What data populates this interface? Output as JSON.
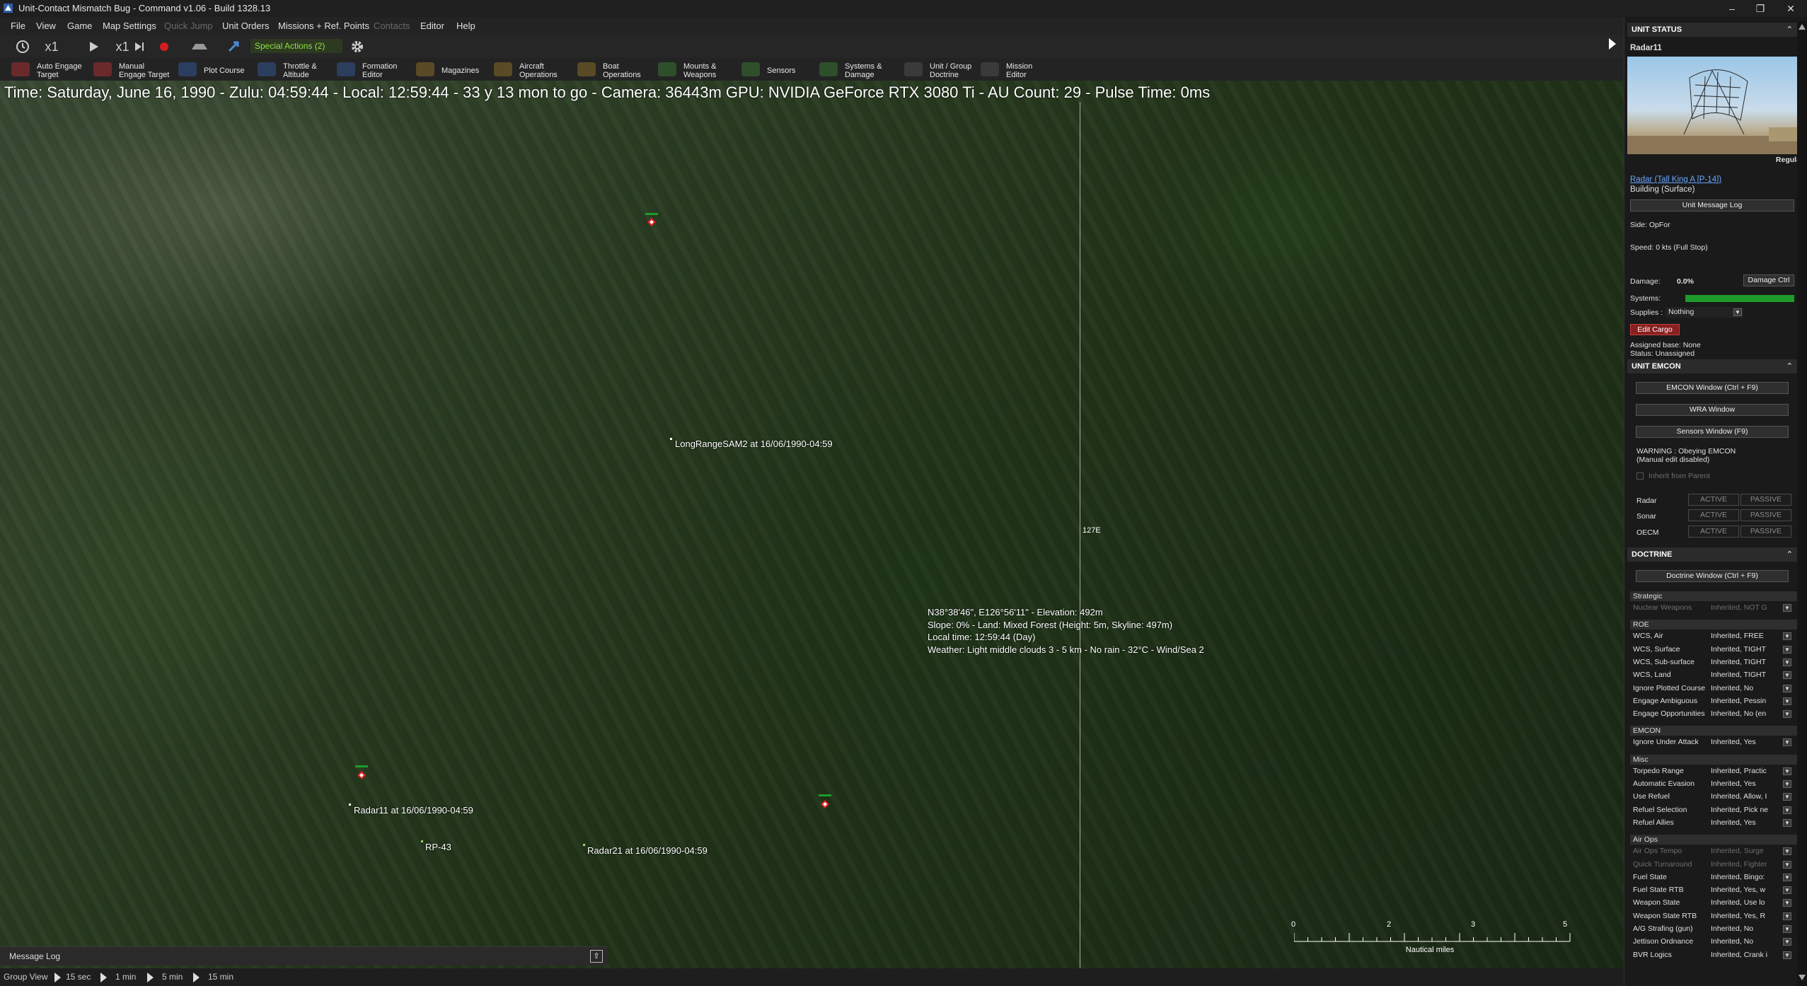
{
  "window": {
    "title": "Unit-Contact Mismatch Bug  - Command v1.06 - Build 1328.13",
    "controls": [
      "–",
      "❐",
      "✕"
    ]
  },
  "menu": {
    "items": [
      {
        "label": "File",
        "enabled": true
      },
      {
        "label": "View",
        "enabled": true
      },
      {
        "label": "Game",
        "enabled": true
      },
      {
        "label": "Map Settings",
        "enabled": true
      },
      {
        "label": "Quick Jump",
        "enabled": false
      },
      {
        "label": "Unit Orders",
        "enabled": true
      },
      {
        "label": "Missions + Ref. Points",
        "enabled": true
      },
      {
        "label": "Contacts",
        "enabled": false
      },
      {
        "label": "Editor",
        "enabled": true
      },
      {
        "label": "Help",
        "enabled": true
      }
    ]
  },
  "controls": {
    "speed1": "x1",
    "speed2": "x1",
    "special_actions": "Special Actions (2)"
  },
  "toolbar": {
    "buttons": [
      {
        "line1": "Auto Engage",
        "line2": "Target",
        "color": "#6b2a2a"
      },
      {
        "line1": "Manual",
        "line2": "Engage Target",
        "color": "#6b2a2a"
      },
      {
        "line1": "Plot Course",
        "line2": "",
        "color": "#2c3e5e"
      },
      {
        "line1": "Throttle &",
        "line2": "Altitude",
        "color": "#2c3e5e"
      },
      {
        "line1": "Formation",
        "line2": "Editor",
        "color": "#2c3e5e"
      },
      {
        "line1": "Magazines",
        "line2": "",
        "color": "#5a4a25"
      },
      {
        "line1": "Aircraft",
        "line2": "Operations",
        "color": "#5a4a25"
      },
      {
        "line1": "Boat",
        "line2": "Operations",
        "color": "#5a4a25"
      },
      {
        "line1": "Mounts &",
        "line2": "Weapons",
        "color": "#2e4f2a"
      },
      {
        "line1": "Sensors",
        "line2": "",
        "color": "#2e4f2a"
      },
      {
        "line1": "Systems &",
        "line2": "Damage",
        "color": "#2e4f2a"
      },
      {
        "line1": "Unit / Group",
        "line2": "Doctrine",
        "color": "#3a3a3a"
      },
      {
        "line1": "Mission",
        "line2": "Editor",
        "color": "#3a3a3a"
      }
    ]
  },
  "status_line": "Time: Saturday, June 16, 1990 - Zulu: 04:59:44 - Local: 12:59:44 - 33 y 13 mon to go -  Camera: 36443m  GPU: NVIDIA GeForce RTX 3080 Ti - AU Count: 29 - Pulse Time: 0ms",
  "map": {
    "meridian_label": "127E",
    "labels": {
      "sam": "LongRangeSAM2 at 16/06/1990-04:59",
      "radar11": "Radar11 at 16/06/1990-04:59",
      "rp43": "RP-43",
      "radar21": "Radar21 at 16/06/1990-04:59"
    },
    "cursor_info": [
      "N38°38'46\", E126°56'11\" - Elevation: 492m",
      "Slope: 0%  - Land: Mixed Forest (Height: 5m, Skyline: 497m)",
      "Local time: 12:59:44 (Day)",
      "Weather: Light middle clouds 3 - 5 km - No rain - 32°C - Wind/Sea 2"
    ],
    "scale": {
      "ticks": [
        "0",
        "2",
        "3",
        "5"
      ],
      "unit": "Nautical miles"
    }
  },
  "message_log": {
    "label": "Message Log"
  },
  "group_view": {
    "label": "Group View",
    "steps": [
      "15 sec",
      "1 min",
      "5 min",
      "15 min"
    ]
  },
  "unit_status": {
    "header": "UNIT STATUS",
    "unit_name": "Radar11",
    "proficiency": "Regular",
    "unit_type_link": "Radar (Tall King A [P-14])",
    "category": "Building (Surface)",
    "message_log_button": "Unit Message Log",
    "side": "Side: OpFor",
    "speed": "Speed: 0 kts (Full Stop)",
    "damage_label": "Damage:",
    "damage_value": "0.0%",
    "damage_ctrl": "Damage Ctrl",
    "systems_label": "Systems:",
    "supplies_label": "Supplies :",
    "supplies_value": "Nothing",
    "edit_cargo": "Edit Cargo",
    "assigned_base": "Assigned base: None",
    "status": "Status: Unassigned"
  },
  "emcon": {
    "header": "UNIT EMCON",
    "buttons": [
      "EMCON Window (Ctrl + F9)",
      "WRA Window",
      "Sensors Window (F9)"
    ],
    "warning1": "WARNING : Obeying EMCON",
    "warning2": "(Manual edit disabled)",
    "inherit": "Inherit from Parent",
    "rows": [
      {
        "label": "Radar",
        "active": "ACTIVE",
        "passive": "PASSIVE"
      },
      {
        "label": "Sonar",
        "active": "ACTIVE",
        "passive": "PASSIVE"
      },
      {
        "label": "OECM",
        "active": "ACTIVE",
        "passive": "PASSIVE"
      }
    ]
  },
  "doctrine": {
    "header": "DOCTRINE",
    "button": "Doctrine Window (Ctrl + F9)",
    "groups": [
      {
        "title": "Strategic",
        "rows": [
          {
            "k": "Nuclear Weapons",
            "v": "Inherited, NOT G",
            "disabled": true
          }
        ]
      },
      {
        "title": "ROE",
        "rows": [
          {
            "k": "WCS, Air",
            "v": "Inherited, FREE",
            "disabled": false
          },
          {
            "k": "WCS, Surface",
            "v": "Inherited, TIGHT",
            "disabled": false
          },
          {
            "k": "WCS, Sub-surface",
            "v": "Inherited, TIGHT",
            "disabled": false
          },
          {
            "k": "WCS, Land",
            "v": "Inherited, TIGHT",
            "disabled": false
          },
          {
            "k": "Ignore Plotted Course",
            "v": "Inherited, No",
            "disabled": false
          },
          {
            "k": "Engage Ambiguous",
            "v": "Inherited, Pessin",
            "disabled": false
          },
          {
            "k": "Engage Opportunities",
            "v": "Inherited, No (en",
            "disabled": false
          }
        ]
      },
      {
        "title": "EMCON",
        "rows": [
          {
            "k": "Ignore Under Attack",
            "v": "Inherited, Yes",
            "disabled": false
          }
        ]
      },
      {
        "title": "Misc",
        "rows": [
          {
            "k": "Torpedo Range",
            "v": "Inherited, Practic",
            "disabled": false
          },
          {
            "k": "Automatic Evasion",
            "v": "Inherited, Yes",
            "disabled": false
          },
          {
            "k": "Use Refuel",
            "v": "Inherited, Allow, I",
            "disabled": false
          },
          {
            "k": "Refuel Selection",
            "v": "Inherited, Pick ne",
            "disabled": false
          },
          {
            "k": "Refuel Allies",
            "v": "Inherited, Yes",
            "disabled": false
          }
        ]
      },
      {
        "title": "Air Ops",
        "rows": [
          {
            "k": "Air Ops Tempo",
            "v": "Inherited, Surge",
            "disabled": true
          },
          {
            "k": "Quick Turnaround",
            "v": "Inherited, Fighter",
            "disabled": true
          },
          {
            "k": "Fuel State",
            "v": "Inherited, Bingo:",
            "disabled": false
          },
          {
            "k": "Fuel State RTB",
            "v": "Inherited, Yes, w",
            "disabled": false
          },
          {
            "k": "Weapon State",
            "v": "Inherited, Use lo",
            "disabled": false
          },
          {
            "k": "Weapon State RTB",
            "v": "Inherited, Yes, R",
            "disabled": false
          },
          {
            "k": "A/G Strafing (gun)",
            "v": "Inherited, No",
            "disabled": false
          },
          {
            "k": "Jettison Ordnance",
            "v": "Inherited, No",
            "disabled": false
          },
          {
            "k": "BVR Logics",
            "v": "Inherited, Crank i",
            "disabled": false
          }
        ]
      }
    ]
  },
  "colors": {
    "accent_green": "#1e9a2a",
    "hostile_red": "#e02020",
    "link_blue": "#6aa6ff"
  }
}
